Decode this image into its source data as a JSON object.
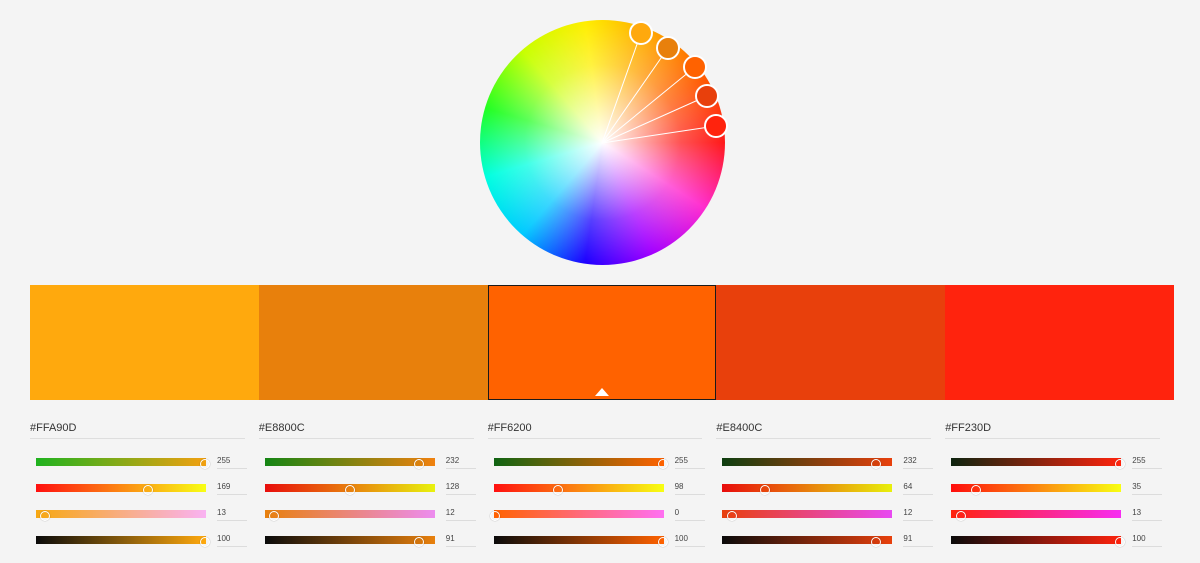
{
  "wheel": {
    "handle_colors": [
      "#FFA90D",
      "#E8800C",
      "#FF6200",
      "#E8400C",
      "#FF230D"
    ]
  },
  "swatches": [
    {
      "hex": "#FFA90D",
      "active": false
    },
    {
      "hex": "#E8800C",
      "active": false
    },
    {
      "hex": "#FF6200",
      "active": true
    },
    {
      "hex": "#E8400C",
      "active": false
    },
    {
      "hex": "#FF230D",
      "active": false
    }
  ],
  "columns": [
    {
      "hex_label": "#FFA90D",
      "sliders": [
        {
          "value": "255",
          "fraction": 1.0,
          "grad": [
            "#1fb21f",
            "#f2a010"
          ]
        },
        {
          "value": "169",
          "fraction": 0.66,
          "grad": [
            "#ff1010",
            "#f8ff15"
          ]
        },
        {
          "value": "13",
          "fraction": 0.05,
          "grad": [
            "#f7a812",
            "#f9b2f2"
          ]
        },
        {
          "value": "100",
          "fraction": 1.0,
          "grad": [
            "#0a0a0a",
            "#ffa90d"
          ]
        }
      ]
    },
    {
      "hex_label": "#E8800C",
      "sliders": [
        {
          "value": "232",
          "fraction": 0.91,
          "grad": [
            "#148514",
            "#f0810e"
          ]
        },
        {
          "value": "128",
          "fraction": 0.5,
          "grad": [
            "#e80d0c",
            "#e8f20e"
          ]
        },
        {
          "value": "12",
          "fraction": 0.05,
          "grad": [
            "#e8800c",
            "#ec8cef"
          ]
        },
        {
          "value": "91",
          "fraction": 0.91,
          "grad": [
            "#0a0a0a",
            "#e8800c"
          ]
        }
      ]
    },
    {
      "hex_label": "#FF6200",
      "sliders": [
        {
          "value": "255",
          "fraction": 1.0,
          "grad": [
            "#0f6312",
            "#ff6200"
          ]
        },
        {
          "value": "98",
          "fraction": 0.38,
          "grad": [
            "#ff1010",
            "#f7ff12"
          ]
        },
        {
          "value": "0",
          "fraction": 0.0,
          "grad": [
            "#ff6200",
            "#ff70f2"
          ]
        },
        {
          "value": "100",
          "fraction": 1.0,
          "grad": [
            "#0a0a0a",
            "#ff6200"
          ]
        }
      ]
    },
    {
      "hex_label": "#E8400C",
      "sliders": [
        {
          "value": "232",
          "fraction": 0.91,
          "grad": [
            "#0d3e10",
            "#e8400c"
          ]
        },
        {
          "value": "64",
          "fraction": 0.25,
          "grad": [
            "#e80c0c",
            "#e8f00c"
          ]
        },
        {
          "value": "12",
          "fraction": 0.05,
          "grad": [
            "#e8400c",
            "#e84af2"
          ]
        },
        {
          "value": "91",
          "fraction": 0.91,
          "grad": [
            "#0a0a0a",
            "#e8400c"
          ]
        }
      ]
    },
    {
      "hex_label": "#FF230D",
      "sliders": [
        {
          "value": "255",
          "fraction": 1.0,
          "grad": [
            "#0d240f",
            "#ff230d"
          ]
        },
        {
          "value": "35",
          "fraction": 0.14,
          "grad": [
            "#ff0d0d",
            "#f8ff12"
          ]
        },
        {
          "value": "13",
          "fraction": 0.05,
          "grad": [
            "#ff230d",
            "#f72cf2"
          ]
        },
        {
          "value": "100",
          "fraction": 1.0,
          "grad": [
            "#0a0a0a",
            "#ff230d"
          ]
        }
      ]
    }
  ]
}
